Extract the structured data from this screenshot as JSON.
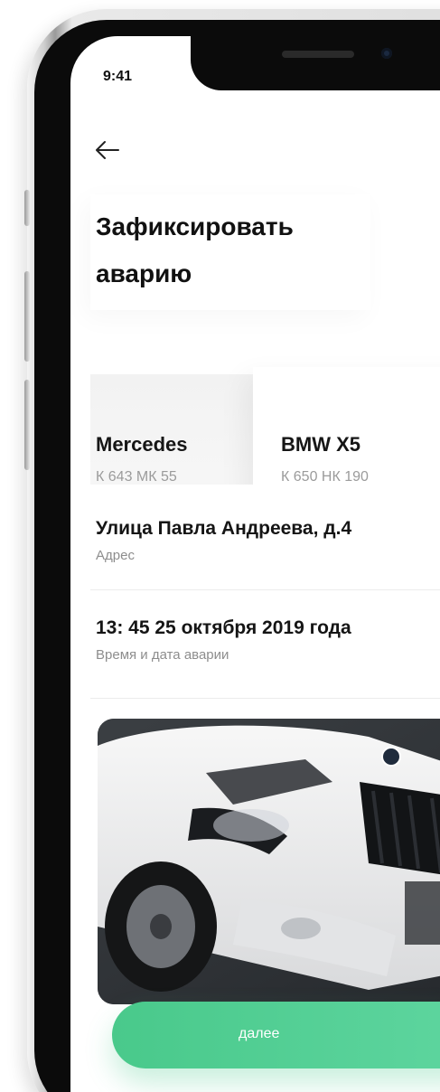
{
  "status_bar": {
    "time": "9:41"
  },
  "header": {
    "back_icon": "arrow-left-icon",
    "title_line1": "Зафиксировать",
    "title_line2": "аварию"
  },
  "vehicles": [
    {
      "name": "Mercedes",
      "plate": "К 643 МК 55",
      "selected": false
    },
    {
      "name": "BMW X5",
      "plate": "К 650 НК 190",
      "selected": true
    }
  ],
  "address": {
    "value": "Улица Павла Андреева, д.4",
    "label": "Адрес"
  },
  "datetime": {
    "value": "13: 45 25 октября 2019 года",
    "label": "Время и дата аварии"
  },
  "photo": {
    "subject": "damaged white BMW front"
  },
  "actions": {
    "next_label": "далее"
  },
  "colors": {
    "accent": "#4ecb91",
    "text_primary": "#151515",
    "text_secondary": "#8d8d8d",
    "phone_bezel": "#0b0b0b"
  }
}
